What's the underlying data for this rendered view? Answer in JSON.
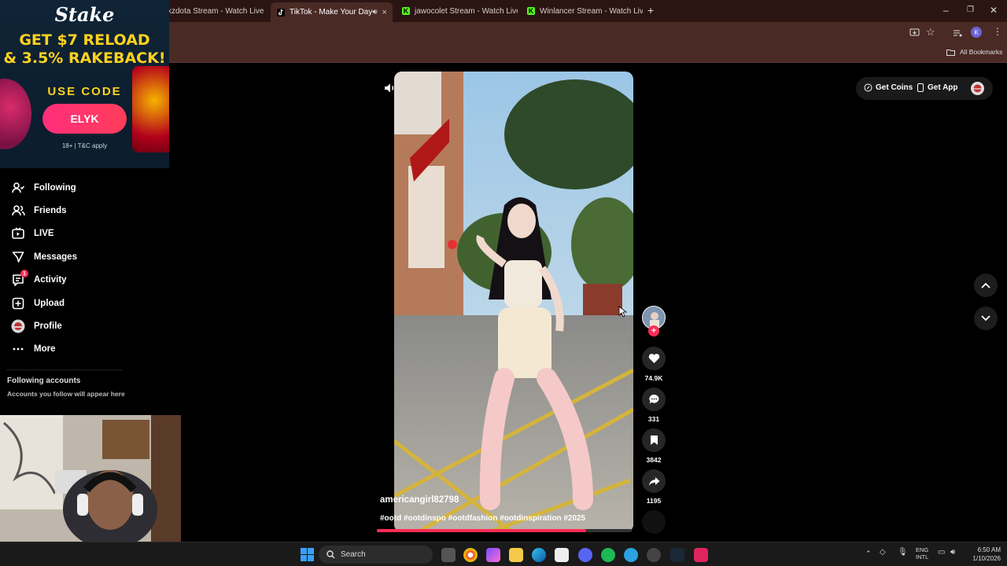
{
  "browser": {
    "tabs": [
      {
        "label": "kzdota Stream - Watch Live",
        "favicon": "kick"
      },
      {
        "label": "TikTok - Make Your Day",
        "favicon": "tiktok",
        "active": true
      },
      {
        "label": "jawocolet Stream - Watch Live",
        "favicon": "kick"
      },
      {
        "label": "Winlancer Stream - Watch Live",
        "favicon": "kick"
      }
    ],
    "new_tab": "+",
    "tab_close": "×",
    "profile_initial": "K",
    "bookmarks_label": "All Bookmarks"
  },
  "ad": {
    "brand": "Stake",
    "headline_line1": "GET $7 RELOAD",
    "headline_line2": "& 3.5% RAKEBACK!",
    "use_code": "USE CODE",
    "code": "ELYK",
    "terms": "18+ | T&C apply"
  },
  "sidebar": {
    "items": [
      {
        "label": "Following",
        "icon": "user-follow-icon"
      },
      {
        "label": "Friends",
        "icon": "friends-icon"
      },
      {
        "label": "LIVE",
        "icon": "live-icon"
      },
      {
        "label": "Messages",
        "icon": "messages-icon"
      },
      {
        "label": "Activity",
        "icon": "activity-icon",
        "badge": "1"
      },
      {
        "label": "Upload",
        "icon": "upload-icon"
      },
      {
        "label": "Profile",
        "icon": "avatar"
      },
      {
        "label": "More",
        "icon": "more-icon"
      }
    ],
    "following_title": "Following accounts",
    "following_hint": "Accounts you follow will appear here"
  },
  "topright": {
    "get_coins": "Get Coins",
    "get_app": "Get App"
  },
  "video": {
    "username": "americangirl82798",
    "caption": "#ootd #ootdinspo #ootdfashion #ootdinspiration #2025",
    "progress": 0.82
  },
  "actions": {
    "likes": "74.9K",
    "comments": "331",
    "saves": "3842",
    "shares": "1195"
  },
  "taskbar": {
    "search_placeholder": "Search",
    "lang_line1": "ENG",
    "lang_line2": "INTL",
    "time": "6:50 AM",
    "date": "1/10/2026"
  },
  "colors": {
    "chrome_dark": "#2a1512",
    "chrome": "#4a2a25",
    "accent_pink": "#fe2c55",
    "ad_yellow": "#ffd21f"
  }
}
